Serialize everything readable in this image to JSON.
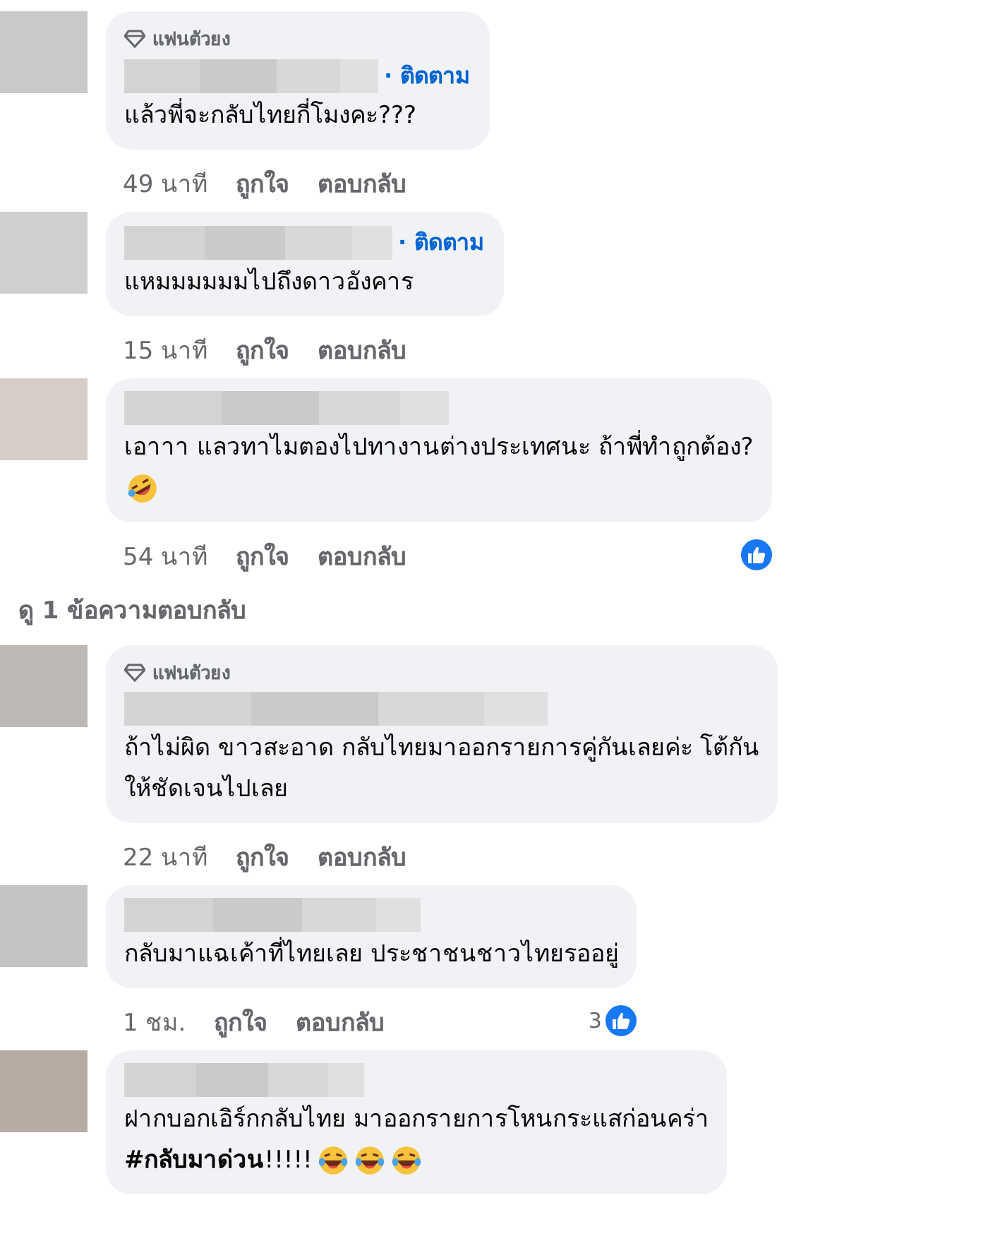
{
  "comments": [
    {
      "badge": "แฟนตัวยง",
      "follow": "· ติดตาม",
      "lines": [
        {
          "text": "แล้วพี่จะกลับไทยกี่โมงคะ???"
        }
      ],
      "time": "49 นาที",
      "like": "ถูกใจ",
      "reply": "ตอบกลับ"
    },
    {
      "follow": "· ติดตาม",
      "lines": [
        {
          "text": "แหมมมมมมไปถึงดาวอังคาร"
        }
      ],
      "time": "15 นาที",
      "like": "ถูกใจ",
      "reply": "ตอบกลับ"
    },
    {
      "lines": [
        {
          "text": "เอาาา แลวทาไมตองไปทางานต่างประเทศนะ ถ้าพี่ทำถูกต้อง?"
        },
        {
          "emoji": [
            {
              "kind": "rolling"
            }
          ]
        }
      ],
      "time": "54 นาที",
      "like": "ถูกใจ",
      "reply": "ตอบกลับ",
      "reaction": {
        "kind": "like"
      },
      "view_replies": "ดู 1 ข้อความตอบกลับ"
    },
    {
      "badge": "แฟนตัวยง",
      "lines": [
        {
          "text": "ถ้าไม่ผิด ขาวสะอาด กลับไทยมาออกรายการคู่กันเลยค่ะ โต้กัน"
        },
        {
          "text": "ให้ชัดเจนไปเลย"
        }
      ],
      "time": "22 นาที",
      "like": "ถูกใจ",
      "reply": "ตอบกลับ"
    },
    {
      "lines": [
        {
          "text": "กลับมาแฉเค้าที่ไทยเลย ประชาชนชาวไทยรออยู่"
        }
      ],
      "time": "1 ชม.",
      "like": "ถูกใจ",
      "reply": "ตอบกลับ",
      "reaction": {
        "kind": "like",
        "count": "3"
      }
    },
    {
      "lines": [
        {
          "text": "ฝากบอกเอิร์กกลับไทย มาออกรายการโหนกระแสก่อนคร่า"
        },
        {
          "text": "**#กลับมาด่วน**!!!!!",
          "emoji": [
            {
              "kind": "tears"
            },
            {
              "kind": "tears"
            },
            {
              "kind": "tears"
            }
          ]
        }
      ]
    }
  ]
}
